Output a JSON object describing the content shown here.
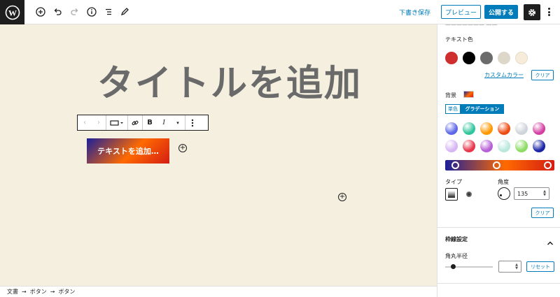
{
  "toolbar": {
    "draft_save": "下書き保存",
    "preview": "プレビュー",
    "publish": "公開する"
  },
  "editor": {
    "title_placeholder": "タイトルを追加",
    "button_text": "テキストを追加…",
    "button_gradient": [
      "#1b1f9a",
      "#ff6a00",
      "#d41d13"
    ],
    "canvas_background": "#f5efe0"
  },
  "block_toolbar": {
    "bold": "B",
    "italic": "I"
  },
  "breadcrumb": [
    "文書",
    "ボタン",
    "ボタン"
  ],
  "breadcrumb_separator": "→",
  "sidebar": {
    "text_color_label": "テキスト色",
    "text_colors": [
      "#cf2e2e",
      "#000000",
      "#6b6b6b",
      "#dcd7c9",
      "#f6ecd9"
    ],
    "custom_color": "カスタムカラー",
    "clear": "クリア",
    "background_label": "背景",
    "tab_solid": "単色",
    "tab_gradient": "グラデーション",
    "gradient_presets": [
      "#5d67e8",
      "#2fc59c",
      "#ff9800",
      "#ee4b10",
      "#cfd4db",
      "#d43fa3",
      "#d6b6f3",
      "#e8354a",
      "#b65fd6",
      "#b9e8dd",
      "#8cdc64",
      "#1a23a6"
    ],
    "type_label": "タイプ",
    "angle_label": "角度",
    "angle_value": "135",
    "clear_2": "クリア",
    "border_settings": "枠線設定",
    "corner_radius": "角丸半径",
    "reset": "リセット"
  }
}
